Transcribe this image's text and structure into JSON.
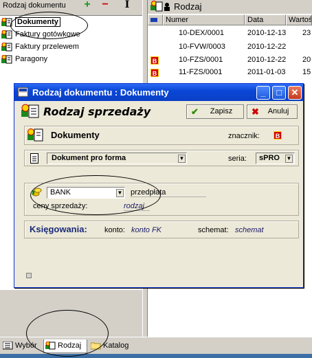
{
  "left_panel": {
    "title": "Rodzaj dokumentu",
    "toolbar": {
      "add": "+",
      "remove": "−",
      "edit": "I"
    },
    "tree": [
      {
        "label": "Dokumenty",
        "selected": true
      },
      {
        "label": "Faktury gotówkowe"
      },
      {
        "label": "Faktury przelewem"
      },
      {
        "label": "Paragony"
      }
    ]
  },
  "right_panel": {
    "title": "Rodzaj",
    "columns": [
      "Numer",
      "Data",
      "Wartoś"
    ],
    "rows": [
      {
        "badge": "",
        "number": "10-DEX/0001",
        "date": "2010-12-13",
        "value": "23"
      },
      {
        "badge": "",
        "number": "10-FVW/0003",
        "date": "2010-12-22",
        "value": ""
      },
      {
        "badge": "B",
        "number": "10-FZS/0001",
        "date": "2010-12-22",
        "value": "20"
      },
      {
        "badge": "B",
        "number": "11-FZS/0001",
        "date": "2011-01-03",
        "value": "15"
      }
    ]
  },
  "bottom_tabs": [
    {
      "label": "Wybór"
    },
    {
      "label": "Rodzaj",
      "active": true
    },
    {
      "label": "Katalog"
    }
  ],
  "dialog": {
    "title": "Rodzaj dokumentu : Dokumenty",
    "header": "Rodzaj sprzedaży",
    "save_label": "Zapisz",
    "cancel_label": "Anuluj",
    "doc_name": "Dokumenty",
    "marker_label": "znacznik:",
    "marker_value": "B",
    "doc_type": "Dokument pro forma",
    "series_label": "seria:",
    "series_value": "sPRO",
    "payment_method": "BANK",
    "prepayment_label": "przedpłata",
    "prices_label": "ceny sprzedaży:",
    "prices_value": "rodzaj",
    "posting_label": "Księgowania:",
    "account_label": "konto:",
    "account_value": "konto FK",
    "scheme_label": "schemat:",
    "scheme_value": "schemat"
  },
  "colors": {
    "titlebar": "#0a47d7",
    "badge": "#d10000",
    "save_check": "#2e8b00",
    "cancel_x": "#cc0000"
  }
}
